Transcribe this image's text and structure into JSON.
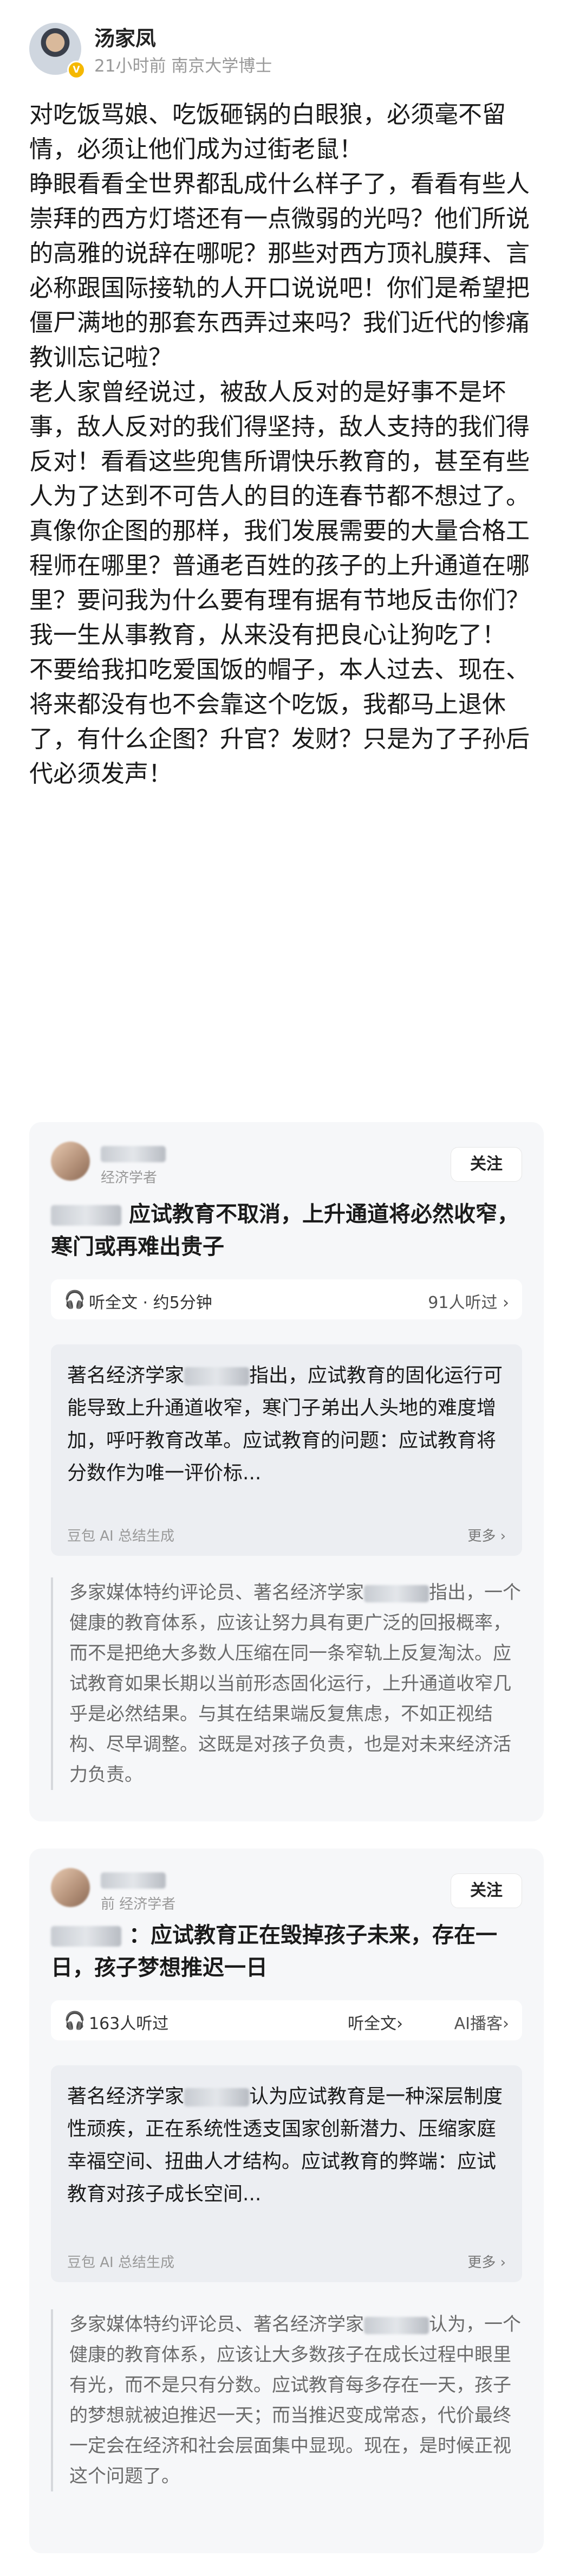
{
  "author": {
    "name": "汤家凤",
    "meta": "21小时前  南京大学博士",
    "badge": "V"
  },
  "post": {
    "paragraphs": [
      "对吃饭骂娘、吃饭砸锅的白眼狼，必须毫不留情，必须让他们成为过街老鼠！",
      "睁眼看看全世界都乱成什么样子了，看看有些人崇拜的西方灯塔还有一点微弱的光吗？他们所说的高雅的说辞在哪呢？那些对西方顶礼膜拜、言必称跟国际接轨的人开口说说吧！你们是希望把僵尸满地的那套东西弄过来吗？我们近代的惨痛教训忘记啦？",
      "老人家曾经说过，被敌人反对的是好事不是坏事，敌人反对的我们得坚持，敌人支持的我们得反对！看看这些兜售所谓快乐教育的，甚至有些人为了达到不可告人的目的连春节都不想过了。真像你企图的那样，我们发展需要的大量合格工程师在哪里？普通老百姓的孩子的上升通道在哪里？要问我为什么要有理有据有节地反击你们？我一生从事教育，从来没有把良心让狗吃了！",
      "不要给我扣吃爱国饭的帽子，本人过去、现在、将来都没有也不会靠这个吃饭，我都马上退休了，有什么企图？升官？发财？只是为了子孙后代必须发声！"
    ]
  },
  "cards": [
    {
      "meta": "经济学者",
      "follow": "关注",
      "title": "应试教育不取消，上升通道将必然收窄，寒门或再难出贵子",
      "audio_left": "听全文 · 约5分钟",
      "audio_right": "91人听过 ›",
      "summary_pre": "著名经济学家",
      "summary": "指出，应试教育的固化运行可能导致上升通道收窄，寒门子弟出人头地的难度增加，呼吁教育改革。应试教育的问题：应试教育将分数作为唯一评价标...",
      "summary_src": "豆包 AI 总结生成",
      "summary_more": "更多 ›",
      "quote_pre": "多家媒体特约评论员、著名经济学家",
      "quote": "指出，一个健康的教育体系，应该让努力具有更广泛的回报概率，而不是把绝大多数人压缩在同一条窄轨上反复淘汰。应试教育如果长期以当前形态固化运行，上升通道收窄几乎是必然结果。与其在结果端反复焦虑，不如正视结构、尽早调整。这既是对孩子负责，也是对未来经济活力负责。"
    },
    {
      "meta": "前  经济学者",
      "follow": "关注",
      "title": "：应试教育正在毁掉孩子未来，存在一日，孩子梦想推迟一日",
      "audio_left": "163人听过",
      "audio_mid": "听全文›",
      "audio_right": "AI播客›",
      "summary_pre": "著名经济学家",
      "summary": "认为应试教育是一种深层制度性顽疾，正在系统性透支国家创新潜力、压缩家庭幸福空间、扭曲人才结构。应试教育的弊端：应试教育对孩子成长空间...",
      "summary_src": "豆包 AI 总结生成",
      "summary_more": "更多 ›",
      "quote_pre": "多家媒体特约评论员、著名经济学家",
      "quote": "认为，一个健康的教育体系，应该让大多数孩子在成长过程中眼里有光，而不是只有分数。应试教育每多存在一天，孩子的梦想就被迫推迟一天；而当推迟变成常态，代价最终一定会在经济和社会层面集中显现。现在，是时候正视这个问题了。"
    }
  ]
}
